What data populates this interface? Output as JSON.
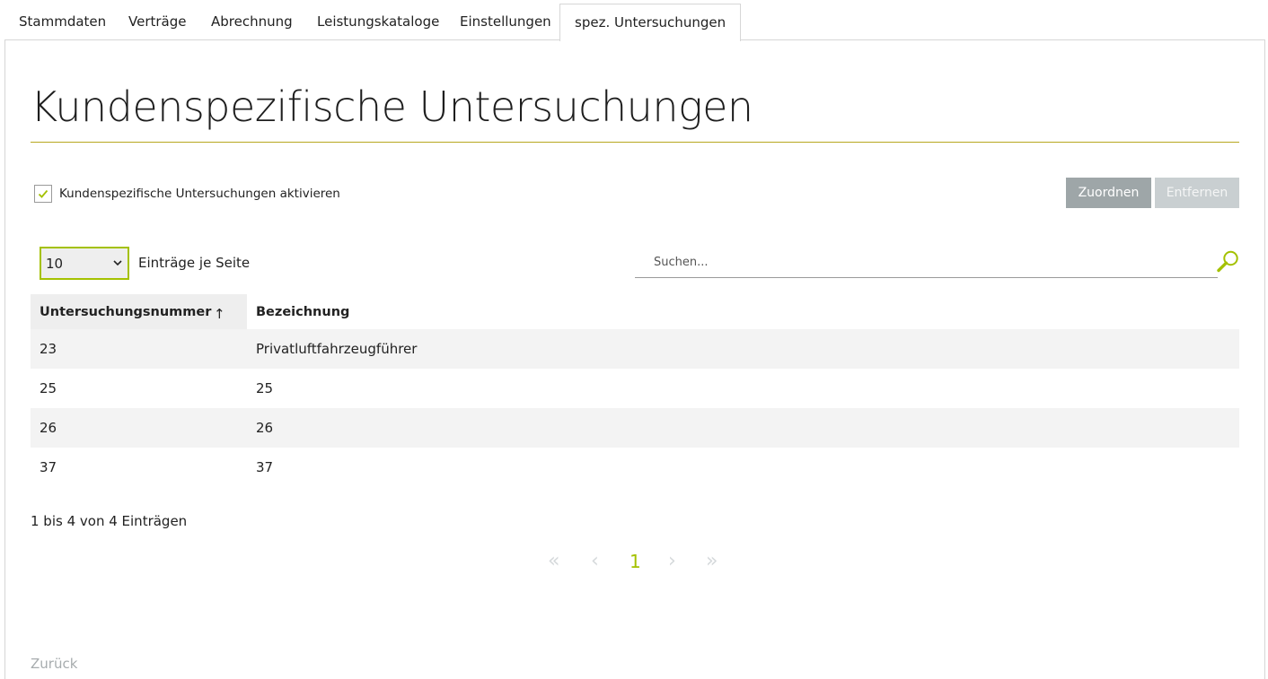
{
  "tabs": [
    {
      "label": "Stammdaten"
    },
    {
      "label": "Verträge"
    },
    {
      "label": "Abrechnung"
    },
    {
      "label": "Leistungskataloge"
    },
    {
      "label": "Einstellungen"
    },
    {
      "label": "spez. Untersuchungen"
    }
  ],
  "page": {
    "title": "Kundenspezifische Untersuchungen",
    "activate_label": "Kundenspezifische Untersuchungen aktivieren",
    "activate_checked": true
  },
  "actions": {
    "assign_label": "Zuordnen",
    "remove_label": "Entfernen"
  },
  "list_controls": {
    "per_page_value": "10",
    "per_page_label": "Einträge je Seite",
    "search_placeholder": "Suchen..."
  },
  "table": {
    "columns": [
      "Untersuchungsnummer",
      "Bezeichnung"
    ],
    "sort_indicator": "↑",
    "rows": [
      [
        "23",
        "Privatluftfahrzeugführer"
      ],
      [
        "25",
        "25"
      ],
      [
        "26",
        "26"
      ],
      [
        "37",
        "37"
      ]
    ]
  },
  "pagination": {
    "info": "1 bis 4 von 4 Einträgen",
    "first": "«",
    "prev": "‹",
    "current": "1",
    "next": "›",
    "last": "»"
  },
  "footer": {
    "back_label": "Zurück"
  },
  "colors": {
    "accent_green": "#a4c100",
    "title_rule": "#b7a820",
    "button_gray": "#9ea6a8",
    "button_disabled": "#c9cfd1"
  },
  "icons": {
    "checkbox": "checkmark-icon",
    "select": "chevron-down-icon",
    "search": "search-icon"
  }
}
